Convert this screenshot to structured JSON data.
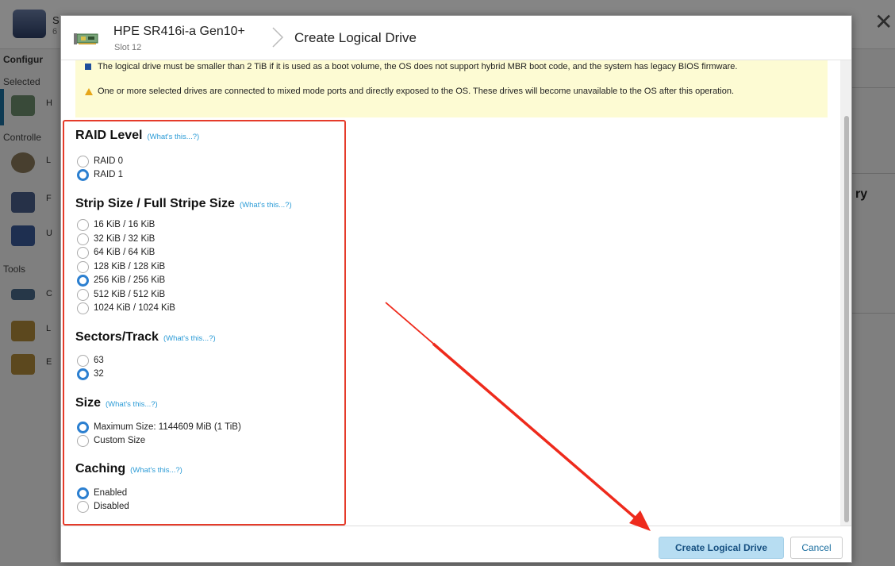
{
  "background": {
    "header_letter": "S",
    "header_sub": "6",
    "sidebar": {
      "configure_label": "Configur",
      "selected_label": "Selected",
      "controllers_label": "Controlle",
      "tools_label": "Tools",
      "item_letters": [
        "H",
        "L",
        "F",
        "U",
        "C",
        "L",
        "E"
      ]
    },
    "right_fragment": "ry"
  },
  "dialog": {
    "controller_name": "HPE SR416i-a Gen10+",
    "controller_slot": "Slot 12",
    "title": "Create Logical Drive",
    "warnings": [
      "The logical drive must be smaller than 2 TiB if it is used as a boot volume, the OS does not support hybrid MBR boot code, and the system has legacy BIOS firmware.",
      "One or more selected drives are connected to mixed mode ports and directly exposed to the OS. These drives will become unavailable to the OS after this operation."
    ],
    "whats_this": "(What's this...?)",
    "groups": {
      "raid": {
        "title": "RAID Level",
        "options": [
          "RAID 0",
          "RAID 1"
        ],
        "selected": "RAID 1"
      },
      "strip": {
        "title": "Strip Size / Full Stripe Size",
        "options": [
          "16 KiB / 16 KiB",
          "32 KiB / 32 KiB",
          "64 KiB / 64 KiB",
          "128 KiB / 128 KiB",
          "256 KiB / 256 KiB",
          "512 KiB / 512 KiB",
          "1024 KiB / 1024 KiB"
        ],
        "selected": "256 KiB / 256 KiB"
      },
      "sectors": {
        "title": "Sectors/Track",
        "options": [
          "63",
          "32"
        ],
        "selected": "32"
      },
      "size": {
        "title": "Size",
        "options": [
          "Maximum Size: 1144609 MiB (1 TiB)",
          "Custom Size"
        ],
        "selected": "Maximum Size: 1144609 MiB (1 TiB)"
      },
      "caching": {
        "title": "Caching",
        "options": [
          "Enabled",
          "Disabled"
        ],
        "selected": "Enabled"
      }
    },
    "buttons": {
      "create": "Create Logical Drive",
      "cancel": "Cancel"
    }
  },
  "colors": {
    "accent": "#2b7fd0",
    "highlight": "#e53b2a",
    "warning_bg": "#fdfbd3",
    "link": "#2b9bd6"
  },
  "icons": [
    "controller-card-icon",
    "breadcrumb-chevron-icon",
    "info-square-icon",
    "warning-triangle-icon",
    "close-icon",
    "lock-icon"
  ]
}
